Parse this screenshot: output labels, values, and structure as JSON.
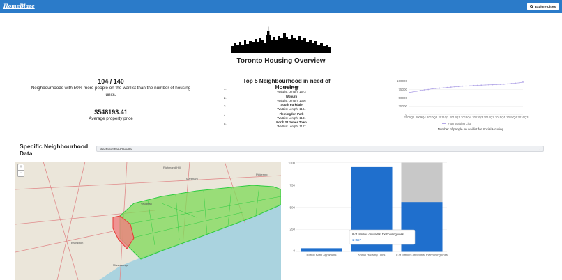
{
  "header": {
    "logo": "HomeBlaze",
    "explore_button": "Explore Cities",
    "explore_icon": "search-icon",
    "accent": "#2b7bc9"
  },
  "title": "Toronto Housing Overview",
  "stats": {
    "ratio": "104 / 140",
    "ratio_desc": "Neighbourhoods with 50% more people on the waitlist than the number of housing units.",
    "price": "$548193.41",
    "price_desc": "Average property price"
  },
  "top5": {
    "title": "Top 5 Neighbourhood in need of Housing",
    "items": [
      {
        "num": "1.",
        "name": "Moss Park",
        "len": "WaitList Length: 1573"
      },
      {
        "num": "2.",
        "name": "Woburn",
        "len": "WaitList Length: 1306"
      },
      {
        "num": "3.",
        "name": "South Parkdale",
        "len": "WaitList Length: 1184"
      },
      {
        "num": "4.",
        "name": "Flemingdon Park",
        "len": "WaitList Length: 1141"
      },
      {
        "num": "5.",
        "name": "North St.James Town",
        "len": "WaitList Length: 1127"
      }
    ]
  },
  "waitlist_chart": {
    "yticks": [
      "100000",
      "75000",
      "50000",
      "25000",
      "0"
    ],
    "xticks": [
      "2009Q1",
      "2009Q4",
      "2010Q3",
      "2011Q2",
      "2012Q1",
      "2012Q4",
      "2013Q3",
      "2014Q2",
      "2015Q1",
      "2015Q4",
      "2016Q3"
    ],
    "legend": "# on Waiting List",
    "caption": "Number of people on waitlist for Social Housing"
  },
  "section": {
    "title": "Specific Neighbourhood Data",
    "selected": "West Humber-Clairville"
  },
  "map": {
    "labels": [
      "Vaughan",
      "Richmond Hill",
      "Markham",
      "Brampton",
      "Mississauga",
      "Pickering"
    ]
  },
  "bar_chart": {
    "yticks": [
      "1000",
      "750",
      "500",
      "250",
      "0"
    ],
    "tooltip_title": "# of families on waitlist for housing units",
    "tooltip_value": "1 : 557"
  },
  "chart_data": [
    {
      "type": "line",
      "title": "",
      "caption": "Number of people on waitlist for Social Housing",
      "series": [
        {
          "name": "# on Waiting List",
          "x": [
            "2009Q1",
            "2009Q2",
            "2009Q3",
            "2009Q4",
            "2010Q1",
            "2010Q2",
            "2010Q3",
            "2010Q4",
            "2011Q1",
            "2011Q2",
            "2011Q3",
            "2011Q4",
            "2012Q1",
            "2012Q2",
            "2012Q3",
            "2012Q4",
            "2013Q1",
            "2013Q2",
            "2013Q3",
            "2013Q4",
            "2014Q1",
            "2014Q2",
            "2014Q3",
            "2014Q4",
            "2015Q1",
            "2015Q2",
            "2015Q3",
            "2015Q4",
            "2016Q1",
            "2016Q2",
            "2016Q3"
          ],
          "values": [
            66000,
            68000,
            70000,
            72000,
            74000,
            75000,
            77000,
            78000,
            79000,
            80000,
            81000,
            82000,
            83000,
            84000,
            85000,
            85500,
            86000,
            87000,
            87500,
            88000,
            88500,
            89000,
            89500,
            90000,
            90500,
            91000,
            92000,
            93000,
            94000,
            95000,
            97000
          ]
        }
      ],
      "ylim": [
        0,
        100000
      ],
      "color": "#b4a8e8"
    },
    {
      "type": "bar",
      "categories": [
        "Rental Bank Applicants",
        "Social Housing Units",
        "# of families on waitlist for housing units"
      ],
      "series": [
        {
          "values": [
            40,
            950,
            557
          ]
        },
        {
          "values": [
            0,
            0,
            1000
          ]
        }
      ],
      "ylim": [
        0,
        1000
      ],
      "colors": [
        "#1f6fcd",
        "#c8c8c8"
      ]
    }
  ]
}
